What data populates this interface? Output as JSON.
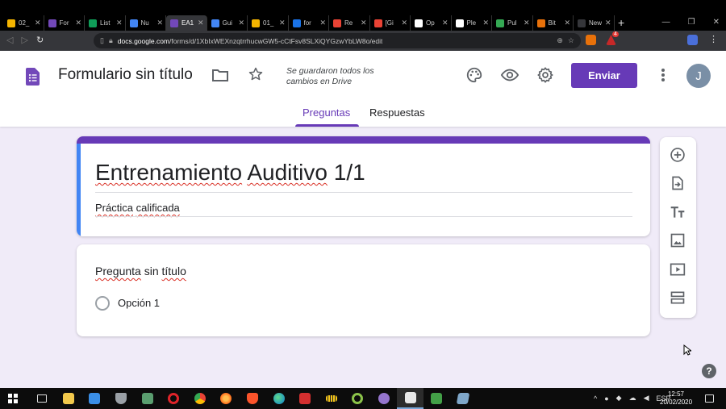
{
  "browser": {
    "tabs": [
      {
        "title": "02_",
        "color": "#f4b400",
        "active": false
      },
      {
        "title": "For",
        "color": "#7248b9",
        "active": false
      },
      {
        "title": "List",
        "color": "#0f9d58",
        "active": false
      },
      {
        "title": "Nu",
        "color": "#4285f4",
        "active": false
      },
      {
        "title": "EA1",
        "color": "#7248b9",
        "active": true
      },
      {
        "title": "Gui",
        "color": "#4285f4",
        "active": false
      },
      {
        "title": "01_",
        "color": "#f4b400",
        "active": false
      },
      {
        "title": "for",
        "color": "#1a73e8",
        "active": false
      },
      {
        "title": "Re",
        "color": "#ea4335",
        "active": false
      },
      {
        "title": "[Gi",
        "color": "#ea4335",
        "active": false
      },
      {
        "title": "Op",
        "color": "#ffffff",
        "active": false
      },
      {
        "title": "Ple",
        "color": "#ffffff",
        "active": false
      },
      {
        "title": "Pul",
        "color": "#34a853",
        "active": false
      },
      {
        "title": "Bit",
        "color": "#e8710a",
        "active": false
      },
      {
        "title": "New Tab",
        "color": "#35363a",
        "active": false
      }
    ],
    "url_domain": "docs.google.com",
    "url_path": "/forms/d/1XbIxWEXnzqtrrhucwGW5-cCtFsv8SLXiQYGzwYbLW8o/edit",
    "extension_badge": "4"
  },
  "header": {
    "form_name": "Formulario sin título",
    "saved_status": "Se guardaron todos los cambios en Drive",
    "send_label": "Enviar",
    "avatar_initial": "J",
    "tabs": [
      "Preguntas",
      "Respuestas"
    ],
    "active_tab": "Preguntas",
    "accent_color": "#673ab7"
  },
  "form": {
    "title": "Entrenamiento Auditivo 1/1",
    "description": "Práctica calificada",
    "question": {
      "title": "Pregunta sin título",
      "options": [
        "Opción 1"
      ]
    }
  },
  "toolbar": {
    "items": [
      "add-question-icon",
      "import-questions-icon",
      "add-title-icon",
      "add-image-icon",
      "add-video-icon",
      "add-section-icon"
    ]
  },
  "help_label": "?",
  "taskbar": {
    "language": "ESP",
    "time": "12:57",
    "date": "20/02/2020"
  }
}
